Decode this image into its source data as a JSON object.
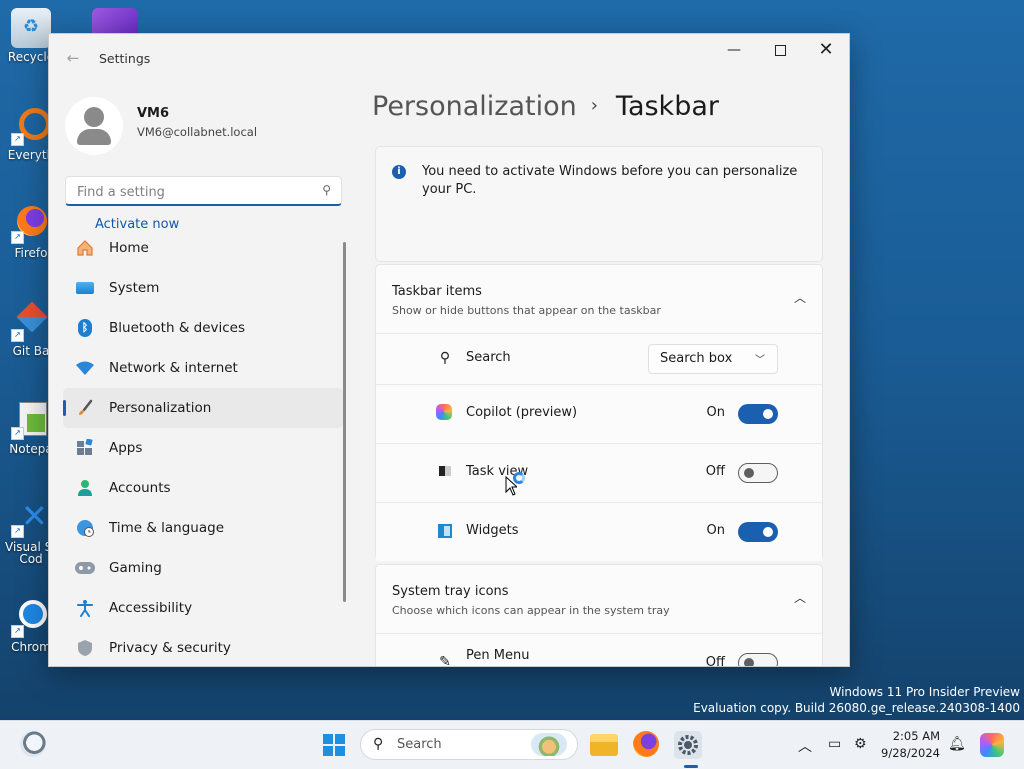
{
  "desktop": {
    "icons": [
      {
        "label": "Recycle"
      },
      {
        "label": "Everyth"
      },
      {
        "label": "Firefo"
      },
      {
        "label": "Git Ba"
      },
      {
        "label": "Notepa"
      },
      {
        "label": "Visual St",
        "label2": "Cod"
      },
      {
        "label": "Chrom"
      }
    ]
  },
  "window": {
    "title": "Settings",
    "back_icon": "arrow-left-icon",
    "minimize_glyph": "—",
    "close_glyph": "✕"
  },
  "user": {
    "name": "VM6",
    "email": "VM6@collabnet.local"
  },
  "sidebar": {
    "search_placeholder": "Find a setting",
    "items": [
      {
        "label": "Home",
        "icon": "home-icon"
      },
      {
        "label": "System",
        "icon": "system-icon"
      },
      {
        "label": "Bluetooth & devices",
        "icon": "bluetooth-icon"
      },
      {
        "label": "Network & internet",
        "icon": "wifi-icon"
      },
      {
        "label": "Personalization",
        "icon": "brush-icon",
        "active": true
      },
      {
        "label": "Apps",
        "icon": "apps-icon"
      },
      {
        "label": "Accounts",
        "icon": "accounts-icon"
      },
      {
        "label": "Time & language",
        "icon": "globe-clock-icon"
      },
      {
        "label": "Gaming",
        "icon": "gamepad-icon"
      },
      {
        "label": "Accessibility",
        "icon": "accessibility-icon"
      },
      {
        "label": "Privacy & security",
        "icon": "shield-icon"
      }
    ]
  },
  "breadcrumb": {
    "parent": "Personalization",
    "separator": "›",
    "current": "Taskbar"
  },
  "notice": {
    "text": "You need to activate Windows before you can personalize your PC.",
    "link": "Activate now"
  },
  "taskbar_items": {
    "title": "Taskbar items",
    "subtitle": "Show or hide buttons that appear on the taskbar",
    "rows": [
      {
        "label": "Search",
        "control": "dropdown",
        "value": "Search box"
      },
      {
        "label": "Copilot (preview)",
        "control": "toggle",
        "state": "On"
      },
      {
        "label": "Task view",
        "control": "toggle",
        "state": "Off"
      },
      {
        "label": "Widgets",
        "control": "toggle",
        "state": "On"
      }
    ]
  },
  "system_tray": {
    "title": "System tray icons",
    "subtitle": "Choose which icons can appear in the system tray",
    "rows": [
      {
        "label": "Pen Menu",
        "control": "toggle",
        "state": "Off"
      }
    ]
  },
  "watermark": {
    "line1": "Windows 11 Pro Insider Preview",
    "line2": "Evaluation copy. Build 26080.ge_release.240308-1400"
  },
  "taskbar": {
    "search_label": "Search",
    "time": "2:05 AM",
    "date": "9/28/2024"
  },
  "colors": {
    "accent": "#1b5fb0",
    "desktop": "#1a5c95"
  }
}
